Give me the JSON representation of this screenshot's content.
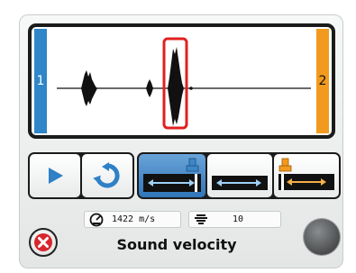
{
  "waveform": {
    "channel_left_label": "1",
    "channel_right_label": "2",
    "colors": {
      "channel_left": "#2f86c8",
      "channel_right": "#f29a1e",
      "gate": "#e02020"
    }
  },
  "controls": {
    "play_icon": "play-icon",
    "reset_icon": "refresh-icon",
    "modes": [
      {
        "name": "through-transmission",
        "active": true
      },
      {
        "name": "channel-1-to-2",
        "active": false
      },
      {
        "name": "channel-2-reflection",
        "active": false
      }
    ]
  },
  "readouts": {
    "velocity_value": "1422 m/s",
    "gain_value": "10"
  },
  "footer": {
    "title": "Sound velocity",
    "close_icon": "close-icon",
    "status_icon": "status-indicator"
  }
}
